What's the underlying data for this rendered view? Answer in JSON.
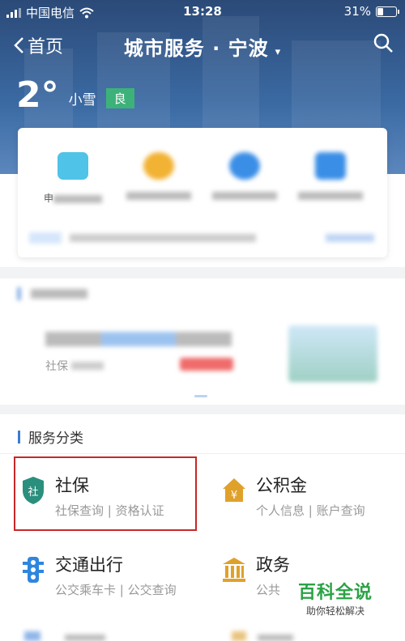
{
  "status_bar": {
    "carrier": "中国电信",
    "time": "13:28",
    "battery": "31%"
  },
  "nav": {
    "back_label": "首页",
    "title": "城市服务 · 宁波",
    "dropdown_glyph": "▾"
  },
  "weather": {
    "temperature": "2°",
    "condition": "小雪",
    "air_quality": "良"
  },
  "quick_services": {
    "tiles": [
      {
        "label": "申",
        "color": "#4fc3e8"
      },
      {
        "label": "",
        "color": "#f2b233"
      },
      {
        "label": "",
        "color": "#3a8ee6"
      },
      {
        "label": "",
        "color": "#3a8ee6"
      }
    ]
  },
  "blurred_section": {
    "sub_text": "社保"
  },
  "service_section": {
    "title": "服务分类",
    "categories": [
      {
        "name": "社保",
        "sub": "社保查询 | 资格认证",
        "icon_color": "#2a8f7d",
        "icon_glyph": "社"
      },
      {
        "name": "公积金",
        "sub": "个人信息 | 账户查询",
        "icon_color": "#e0a12b",
        "icon_glyph": "¥"
      },
      {
        "name": "交通出行",
        "sub": "公交乘车卡 | 公交查询",
        "icon_color": "#2e86de"
      },
      {
        "name": "政务",
        "sub": "公共",
        "icon_color": "#e0a12b"
      }
    ]
  },
  "watermark": {
    "title": "百科全说",
    "subtitle": "助你轻松解决"
  }
}
